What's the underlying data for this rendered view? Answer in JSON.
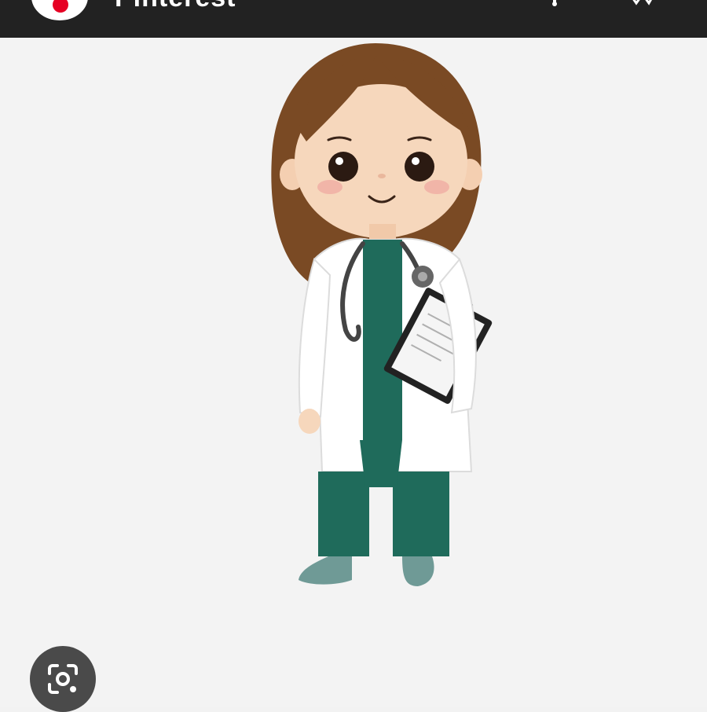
{
  "app": {
    "title": "Pinterest",
    "brand_color": "#e60023",
    "bar_color": "#222222"
  },
  "toolbar": {
    "logo_icon": "pinterest-logo-icon",
    "share_icon": "share-icon",
    "more_icon": "more-icon"
  },
  "image": {
    "subject_icon": "doctor-illustration",
    "colors": {
      "hair": "#7a4a24",
      "skin": "#f6d7bc",
      "coat": "#ffffff",
      "scrubs": "#1f6b5b",
      "shoes": "#6f9a96",
      "clipboard": "#222222"
    }
  },
  "lens": {
    "icon": "lens-search-icon"
  }
}
